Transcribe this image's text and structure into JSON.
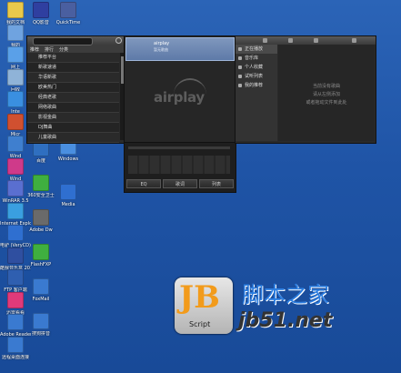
{
  "desktop": {
    "icons_left": [
      {
        "label": "我的文档",
        "color": "#e8c94b"
      },
      {
        "label": "我的",
        "color": "#6fa3e0"
      },
      {
        "label": "网上",
        "color": "#5aa0e8"
      },
      {
        "label": "回收",
        "color": "#8fb3d8"
      },
      {
        "label": "Inte",
        "color": "#3a8fe0"
      },
      {
        "label": "Micr",
        "color": "#d05030"
      },
      {
        "label": "Wind",
        "color": "#3f7fcf"
      },
      {
        "label": "Wind",
        "color": "#cf3a8a"
      },
      {
        "label": "WinRAR 3.5",
        "color": "#5a6fd0"
      },
      {
        "label": "Internet Explorer",
        "color": "#3a9fe0"
      },
      {
        "label": "电驴 (VeryCD)",
        "color": "#2f6fd0"
      },
      {
        "label": "酷我音乐盒 2011",
        "color": "#2f4fa0"
      },
      {
        "label": "FTP 客户端",
        "color": "#2f5fb0"
      },
      {
        "label": "迅雷看看",
        "color": "#e03a7a"
      },
      {
        "label": "Adobe Reader",
        "color": "#3a7ad0"
      },
      {
        "label": "远程桌面连接",
        "color": "#3a7ad0"
      }
    ],
    "icons_col2": [
      {
        "label": "QQ影音",
        "color": "#2f3fa0"
      },
      {
        "label": "暴风",
        "color": "#3a6fd0"
      },
      {
        "label": "迅雷",
        "color": "#4a9fe0"
      },
      {
        "label": "驱动精灵",
        "color": "#3f7fcf"
      },
      {
        "label": "百度",
        "color": "#2f6fc0"
      },
      {
        "label": "360安全卫士",
        "color": "#3faf3f"
      },
      {
        "label": "Adobe Dw",
        "color": "#6a6a6a"
      },
      {
        "label": "FlashFXP",
        "color": "#3faf3f"
      },
      {
        "label": "FoxMail",
        "color": "#3a7ad0"
      },
      {
        "label": "搜狗拼音",
        "color": "#3a7ad0"
      }
    ],
    "icons_col3": [
      {
        "label": "QuickTime",
        "color": "#4a5fa0"
      },
      {
        "label": "360杀毒",
        "color": "#3a8fd0"
      },
      {
        "label": "百度影音",
        "color": "#2f6fd0"
      },
      {
        "label": "Windows",
        "color": "#4a8fe0"
      },
      {
        "label": "Media",
        "color": "#2f6fd0"
      }
    ]
  },
  "player": {
    "left_panel": {
      "tabs": [
        "推荐",
        "排行",
        "分类"
      ],
      "items": [
        "推荐平台",
        "新歌速递",
        "华语新歌",
        "欧美热门",
        "经典老歌",
        "网络歌曲",
        "影视金曲",
        "DJ舞曲",
        "儿童歌曲",
        "轻音乐"
      ]
    },
    "now_playing": {
      "title": "airplay",
      "subtitle": "暂无歌曲"
    },
    "logo_text": "airplay",
    "controls": {
      "buttons": [
        "EQ",
        "歌词",
        "列表"
      ]
    },
    "right_panel": {
      "header": "正在播放",
      "nav": [
        {
          "label": "正在播放",
          "active": true
        },
        {
          "label": "音乐库",
          "active": false
        },
        {
          "label": "个人收藏",
          "active": false
        },
        {
          "label": "试听列表",
          "active": false
        },
        {
          "label": "我的推荐",
          "active": false
        }
      ],
      "empty_lines": [
        "当前没有歌曲",
        "请从左侧添加",
        "或者拖动文件到此处"
      ]
    }
  },
  "watermark": {
    "logo_letters": "JB",
    "logo_sub": "Script",
    "cn_name": "脚本之家",
    "site": "jb51.net"
  }
}
